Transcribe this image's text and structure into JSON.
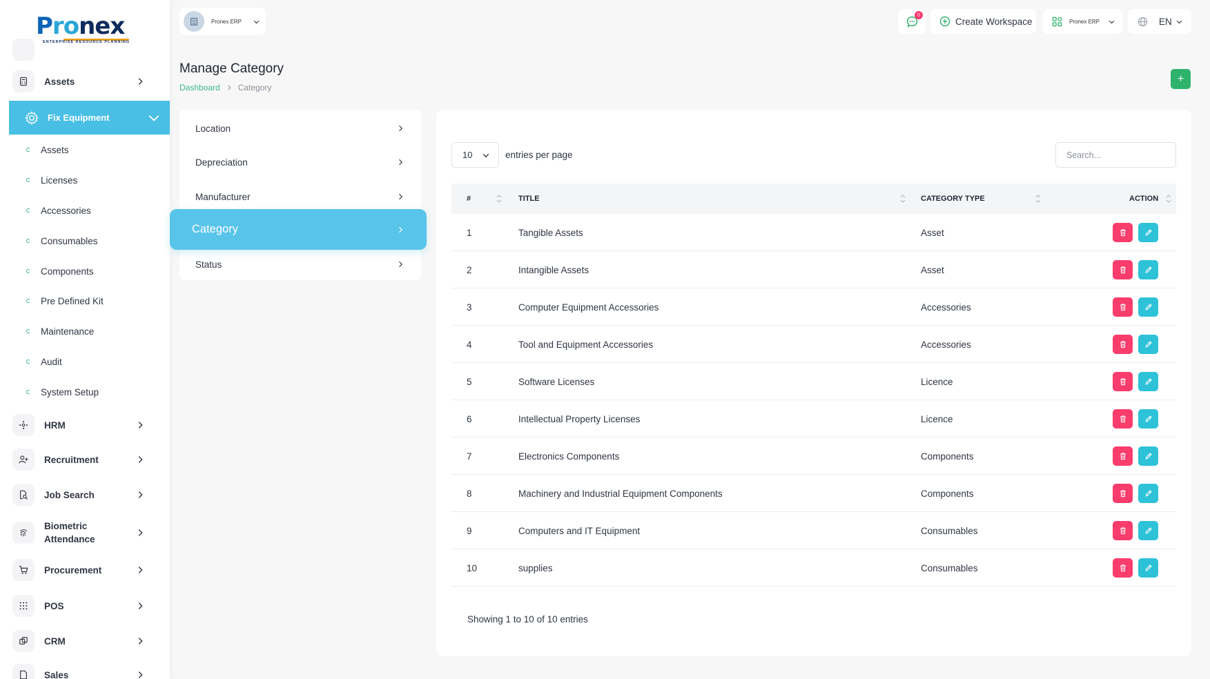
{
  "brand": {
    "wordmark_p": "P",
    "wordmark_r": "ro",
    "wordmark_nex": "nex",
    "tagline": "ENTERPRISE RESOURCE PLANNING"
  },
  "workspace": {
    "name": "Pronex ERP"
  },
  "topbar": {
    "notification_count": "0",
    "create_workspace": "Create Workspace",
    "erp_label": "Pronex ERP",
    "language": "EN"
  },
  "sidebar": {
    "top_items": [
      {
        "label": "Assets"
      }
    ],
    "active": {
      "label": "Fix Equipment"
    },
    "sub_items": [
      {
        "label": "Assets"
      },
      {
        "label": "Licenses"
      },
      {
        "label": "Accessories"
      },
      {
        "label": "Consumables"
      },
      {
        "label": "Components"
      },
      {
        "label": "Pre Defined Kit"
      },
      {
        "label": "Maintenance"
      },
      {
        "label": "Audit"
      },
      {
        "label": "System Setup"
      }
    ],
    "modules": [
      {
        "label": "HRM"
      },
      {
        "label": "Recruitment"
      },
      {
        "label": "Job Search"
      },
      {
        "label": "Biometric Attendance"
      },
      {
        "label": "Procurement"
      },
      {
        "label": "POS"
      },
      {
        "label": "CRM"
      },
      {
        "label": "Sales"
      }
    ]
  },
  "page": {
    "title": "Manage Category",
    "breadcrumb": {
      "home": "Dashboard",
      "current": "Category"
    },
    "add_label": "+"
  },
  "setup_menu": {
    "items": [
      {
        "label": "Location"
      },
      {
        "label": "Depreciation"
      },
      {
        "label": "Manufacturer"
      },
      {
        "label": "Category"
      },
      {
        "label": "Status"
      }
    ],
    "active_index": 3
  },
  "table": {
    "per_page": "10",
    "per_page_label": "entries per page",
    "search_placeholder": "Search...",
    "columns": {
      "num": "#",
      "title": "TITLE",
      "type": "CATEGORY TYPE",
      "action": "ACTION"
    },
    "rows": [
      {
        "num": "1",
        "title": "Tangible Assets",
        "type": "Asset"
      },
      {
        "num": "2",
        "title": "Intangible Assets",
        "type": "Asset"
      },
      {
        "num": "3",
        "title": "Computer Equipment Accessories",
        "type": "Accessories"
      },
      {
        "num": "4",
        "title": "Tool and Equipment Accessories",
        "type": "Accessories"
      },
      {
        "num": "5",
        "title": "Software Licenses",
        "type": "Licence"
      },
      {
        "num": "6",
        "title": "Intellectual Property Licenses",
        "type": "Licence"
      },
      {
        "num": "7",
        "title": "Electronics Components",
        "type": "Components"
      },
      {
        "num": "8",
        "title": "Machinery and Industrial Equipment Components",
        "type": "Components"
      },
      {
        "num": "9",
        "title": "Computers and IT Equipment",
        "type": "Consumables"
      },
      {
        "num": "10",
        "title": "supplies",
        "type": "Consumables"
      }
    ],
    "footer": "Showing 1 to 10 of 10 entries"
  },
  "colors": {
    "accent_blue": "#49bfe5",
    "accent_green": "#3db58a",
    "delete_red": "#fa3d6c",
    "edit_teal": "#2ec2d8",
    "add_green": "#2fb36c"
  }
}
